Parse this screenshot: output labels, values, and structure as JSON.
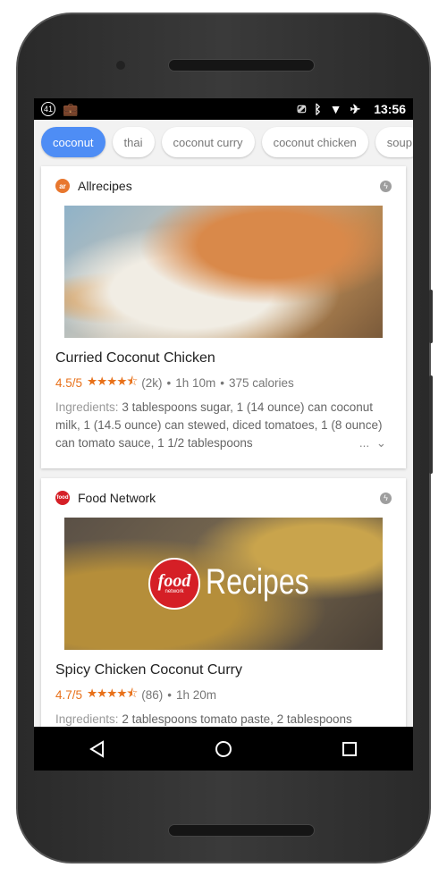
{
  "status_bar": {
    "notification_count": "41",
    "time": "13:56",
    "icons": [
      "notification-count-icon",
      "work-briefcase-icon",
      "cast-icon",
      "bluetooth-icon",
      "wifi-icon",
      "airplane-mode-icon"
    ]
  },
  "chips": [
    {
      "label": "coconut",
      "active": true
    },
    {
      "label": "thai"
    },
    {
      "label": "coconut curry"
    },
    {
      "label": "coconut chicken"
    },
    {
      "label": "soup"
    }
  ],
  "cards": [
    {
      "source": "Allrecipes",
      "logo_text": "ar",
      "logo_color": "#e8772e",
      "title": "Curried Coconut Chicken",
      "rating": "4.5/5",
      "stars": "★★★★⯪",
      "reviews": "(2k)",
      "time": "1h 10m",
      "calories": "375 calories",
      "ingredients_label": "Ingredients:",
      "ingredients": "3 tablespoons sugar, 1 (14 ounce) can coconut milk, 1 (14.5 ounce) can stewed, diced tomatoes, 1 (8 ounce) can tomato sauce, 1 1/2 tablespoons",
      "more": "..."
    },
    {
      "source": "Food Network",
      "logo_text": "food",
      "logo_color": "#d51f26",
      "image_logo_text": "food",
      "image_logo_sub": "network",
      "image_text": "Recipes",
      "title": "Spicy Chicken Coconut Curry",
      "rating": "4.7/5",
      "stars": "★★★★⯪",
      "reviews": "(86)",
      "time": "1h 20m",
      "ingredients_label": "Ingredients:",
      "ingredients": "2 tablespoons tomato paste, 2 tablespoons"
    }
  ],
  "colors": {
    "accent": "#4e8df5",
    "rating": "#e8711a"
  }
}
